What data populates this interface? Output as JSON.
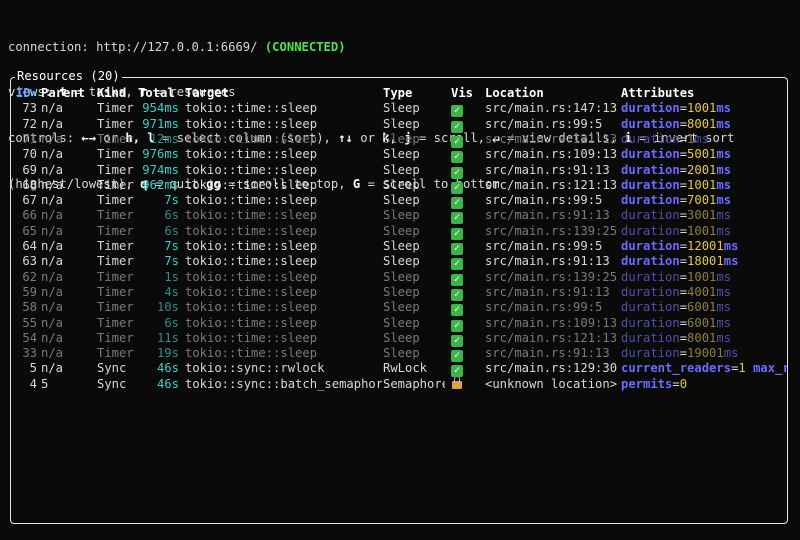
{
  "header": {
    "connection_label": "connection: ",
    "connection_url": "http://127.0.0.1:6669/",
    "connection_status": "(CONNECTED)",
    "views_line": [
      {
        "t": "views: ",
        "b": false
      },
      {
        "t": "t",
        "b": true
      },
      {
        "t": " = tasks, ",
        "b": false
      },
      {
        "t": "r",
        "b": true
      },
      {
        "t": " = resources",
        "b": false
      }
    ],
    "controls_line1": [
      {
        "t": "controls: ",
        "b": false
      },
      {
        "t": "←→",
        "b": true
      },
      {
        "t": " or ",
        "b": false
      },
      {
        "t": "h, l",
        "b": true
      },
      {
        "t": " = select column (sort), ",
        "b": false
      },
      {
        "t": "↑↓",
        "b": true
      },
      {
        "t": " or ",
        "b": false
      },
      {
        "t": "k, j",
        "b": true
      },
      {
        "t": " = scroll, ",
        "b": false
      },
      {
        "t": "↵",
        "b": true
      },
      {
        "t": " = view details, ",
        "b": false
      },
      {
        "t": "i",
        "b": true
      },
      {
        "t": " = invert sort",
        "b": false
      }
    ],
    "controls_line2": [
      {
        "t": "(highest/lowest), ",
        "b": false
      },
      {
        "t": "q",
        "b": true
      },
      {
        "t": " = quit ",
        "b": false
      },
      {
        "t": "gg",
        "b": true
      },
      {
        "t": " = scroll to top, ",
        "b": false
      },
      {
        "t": "G",
        "b": true
      },
      {
        "t": " = scroll to bottom",
        "b": false
      }
    ]
  },
  "panel": {
    "title": "Resources (20)",
    "columns": {
      "id": "ID▾",
      "parent": "Parent",
      "kind": "Kind",
      "total": "Total",
      "target": "Target",
      "type": "Type",
      "vis": "Vis",
      "location": "Location",
      "attributes": "Attributes"
    },
    "rows": [
      {
        "id": "73",
        "parent": "n/a",
        "kind": "Timer",
        "total_num": "954",
        "total_unit": "ms",
        "target": "tokio::time::sleep",
        "type": "Sleep",
        "vis": "check",
        "location": "src/main.rs:147:13",
        "attrs": [
          {
            "k": "duration",
            "v": "1001",
            "u": "ms"
          }
        ],
        "dim": false
      },
      {
        "id": "72",
        "parent": "n/a",
        "kind": "Timer",
        "total_num": "971",
        "total_unit": "ms",
        "target": "tokio::time::sleep",
        "type": "Sleep",
        "vis": "check",
        "location": "src/main.rs:99:5",
        "attrs": [
          {
            "k": "duration",
            "v": "8001",
            "u": "ms"
          }
        ],
        "dim": false
      },
      {
        "id": "71",
        "parent": "n/a",
        "kind": "Timer",
        "total_num": "12",
        "total_unit": "ms",
        "target": "tokio::time::sleep",
        "type": "Sleep",
        "vis": "check",
        "location": "src/main.rs:121:13",
        "attrs": [
          {
            "k": "duration",
            "v": "1",
            "u": "ms"
          }
        ],
        "dim": true
      },
      {
        "id": "70",
        "parent": "n/a",
        "kind": "Timer",
        "total_num": "976",
        "total_unit": "ms",
        "target": "tokio::time::sleep",
        "type": "Sleep",
        "vis": "check",
        "location": "src/main.rs:109:13",
        "attrs": [
          {
            "k": "duration",
            "v": "5001",
            "u": "ms"
          }
        ],
        "dim": false
      },
      {
        "id": "69",
        "parent": "n/a",
        "kind": "Timer",
        "total_num": "974",
        "total_unit": "ms",
        "target": "tokio::time::sleep",
        "type": "Sleep",
        "vis": "check",
        "location": "src/main.rs:91:13",
        "attrs": [
          {
            "k": "duration",
            "v": "2001",
            "u": "ms"
          }
        ],
        "dim": false
      },
      {
        "id": "68",
        "parent": "n/a",
        "kind": "Timer",
        "total_num": "962",
        "total_unit": "ms",
        "target": "tokio::time::sleep",
        "type": "Sleep",
        "vis": "check",
        "location": "src/main.rs:121:13",
        "attrs": [
          {
            "k": "duration",
            "v": "1001",
            "u": "ms"
          }
        ],
        "dim": false
      },
      {
        "id": "67",
        "parent": "n/a",
        "kind": "Timer",
        "total_num": "7",
        "total_unit": "s",
        "target": "tokio::time::sleep",
        "type": "Sleep",
        "vis": "check",
        "location": "src/main.rs:99:5",
        "attrs": [
          {
            "k": "duration",
            "v": "7001",
            "u": "ms"
          }
        ],
        "dim": false
      },
      {
        "id": "66",
        "parent": "n/a",
        "kind": "Timer",
        "total_num": "6",
        "total_unit": "s",
        "target": "tokio::time::sleep",
        "type": "Sleep",
        "vis": "check",
        "location": "src/main.rs:91:13",
        "attrs": [
          {
            "k": "duration",
            "v": "3001",
            "u": "ms"
          }
        ],
        "dim": true
      },
      {
        "id": "65",
        "parent": "n/a",
        "kind": "Timer",
        "total_num": "6",
        "total_unit": "s",
        "target": "tokio::time::sleep",
        "type": "Sleep",
        "vis": "check",
        "location": "src/main.rs:139:25",
        "attrs": [
          {
            "k": "duration",
            "v": "1001",
            "u": "ms"
          }
        ],
        "dim": true
      },
      {
        "id": "64",
        "parent": "n/a",
        "kind": "Timer",
        "total_num": "7",
        "total_unit": "s",
        "target": "tokio::time::sleep",
        "type": "Sleep",
        "vis": "check",
        "location": "src/main.rs:99:5",
        "attrs": [
          {
            "k": "duration",
            "v": "12001",
            "u": "ms"
          }
        ],
        "dim": false
      },
      {
        "id": "63",
        "parent": "n/a",
        "kind": "Timer",
        "total_num": "7",
        "total_unit": "s",
        "target": "tokio::time::sleep",
        "type": "Sleep",
        "vis": "check",
        "location": "src/main.rs:91:13",
        "attrs": [
          {
            "k": "duration",
            "v": "18001",
            "u": "ms"
          }
        ],
        "dim": false
      },
      {
        "id": "62",
        "parent": "n/a",
        "kind": "Timer",
        "total_num": "1",
        "total_unit": "s",
        "target": "tokio::time::sleep",
        "type": "Sleep",
        "vis": "check",
        "location": "src/main.rs:139:25",
        "attrs": [
          {
            "k": "duration",
            "v": "1001",
            "u": "ms"
          }
        ],
        "dim": true
      },
      {
        "id": "59",
        "parent": "n/a",
        "kind": "Timer",
        "total_num": "4",
        "total_unit": "s",
        "target": "tokio::time::sleep",
        "type": "Sleep",
        "vis": "check",
        "location": "src/main.rs:91:13",
        "attrs": [
          {
            "k": "duration",
            "v": "4001",
            "u": "ms"
          }
        ],
        "dim": true
      },
      {
        "id": "58",
        "parent": "n/a",
        "kind": "Timer",
        "total_num": "10",
        "total_unit": "s",
        "target": "tokio::time::sleep",
        "type": "Sleep",
        "vis": "check",
        "location": "src/main.rs:99:5",
        "attrs": [
          {
            "k": "duration",
            "v": "6001",
            "u": "ms"
          }
        ],
        "dim": true
      },
      {
        "id": "55",
        "parent": "n/a",
        "kind": "Timer",
        "total_num": "6",
        "total_unit": "s",
        "target": "tokio::time::sleep",
        "type": "Sleep",
        "vis": "check",
        "location": "src/main.rs:109:13",
        "attrs": [
          {
            "k": "duration",
            "v": "6001",
            "u": "ms"
          }
        ],
        "dim": true
      },
      {
        "id": "54",
        "parent": "n/a",
        "kind": "Timer",
        "total_num": "11",
        "total_unit": "s",
        "target": "tokio::time::sleep",
        "type": "Sleep",
        "vis": "check",
        "location": "src/main.rs:121:13",
        "attrs": [
          {
            "k": "duration",
            "v": "8001",
            "u": "ms"
          }
        ],
        "dim": true
      },
      {
        "id": "33",
        "parent": "n/a",
        "kind": "Timer",
        "total_num": "19",
        "total_unit": "s",
        "target": "tokio::time::sleep",
        "type": "Sleep",
        "vis": "check",
        "location": "src/main.rs:91:13",
        "attrs": [
          {
            "k": "duration",
            "v": "19001",
            "u": "ms"
          }
        ],
        "dim": true
      },
      {
        "id": "5",
        "parent": "n/a",
        "kind": "Sync",
        "total_num": "46",
        "total_unit": "s",
        "target": "tokio::sync::rwlock",
        "type": "RwLock",
        "vis": "check",
        "location": "src/main.rs:129:30",
        "attrs": [
          {
            "k": "current_readers",
            "v": "1",
            "u": ""
          },
          {
            "k": "max_re",
            "v": "",
            "u": ""
          }
        ],
        "dim": false
      },
      {
        "id": "4",
        "parent": "5",
        "kind": "Sync",
        "total_num": "46",
        "total_unit": "s",
        "target": "tokio::sync::batch_semaphore",
        "type": "Semaphore",
        "vis": "lock",
        "location": "<unknown location>",
        "attrs": [
          {
            "k": "permits",
            "v": "0",
            "u": ""
          }
        ],
        "dim": false
      }
    ]
  }
}
